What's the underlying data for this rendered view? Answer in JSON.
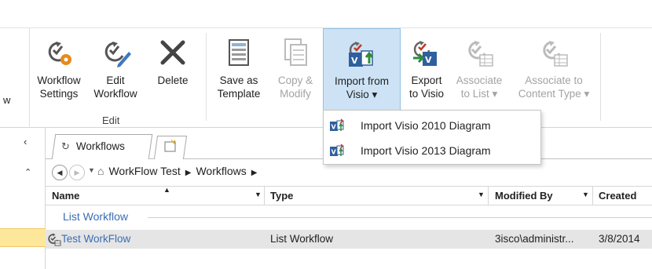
{
  "ribbon": {
    "cut_label": "w",
    "groups": [
      {
        "label": "Edit"
      }
    ],
    "buttons": [
      {
        "label_line1": "Workflow",
        "label_line2": "Settings"
      },
      {
        "label_line1": "Edit",
        "label_line2": "Workflow"
      },
      {
        "label_line1": "Delete",
        "label_line2": ""
      },
      {
        "label_line1": "Save as",
        "label_line2": "Template"
      },
      {
        "label_line1": "Copy &",
        "label_line2": "Modify"
      },
      {
        "label_line1": "Import from",
        "label_line2": "Visio ▾"
      },
      {
        "label_line1": "Export",
        "label_line2": "to Visio"
      },
      {
        "label_line1": "Associate",
        "label_line2": "to List ▾"
      },
      {
        "label_line1": "Associate to",
        "label_line2": "Content Type ▾"
      }
    ]
  },
  "menu": {
    "items": [
      {
        "label": "Import Visio 2010 Diagram",
        "accel": "I"
      },
      {
        "label": "Import Visio 2013 Diagram",
        "accel": "I"
      }
    ]
  },
  "tabs": [
    {
      "label": "Workflows"
    }
  ],
  "breadcrumb": {
    "items": [
      "WorkFlow Test",
      "Workflows"
    ]
  },
  "table": {
    "columns": [
      "Name",
      "Type",
      "Modified By",
      "Created"
    ],
    "group_label": "List Workflow",
    "rows": [
      {
        "name": "Test WorkFlow",
        "type": "List Workflow",
        "modified_by": "3isco\\administr...",
        "created": "3/8/2014"
      }
    ]
  },
  "colors": {
    "accent": "#3a6db5",
    "selected_button": "#cde3f5",
    "selected_row": "#e5e5e5",
    "nav_highlight": "#fde79b"
  }
}
